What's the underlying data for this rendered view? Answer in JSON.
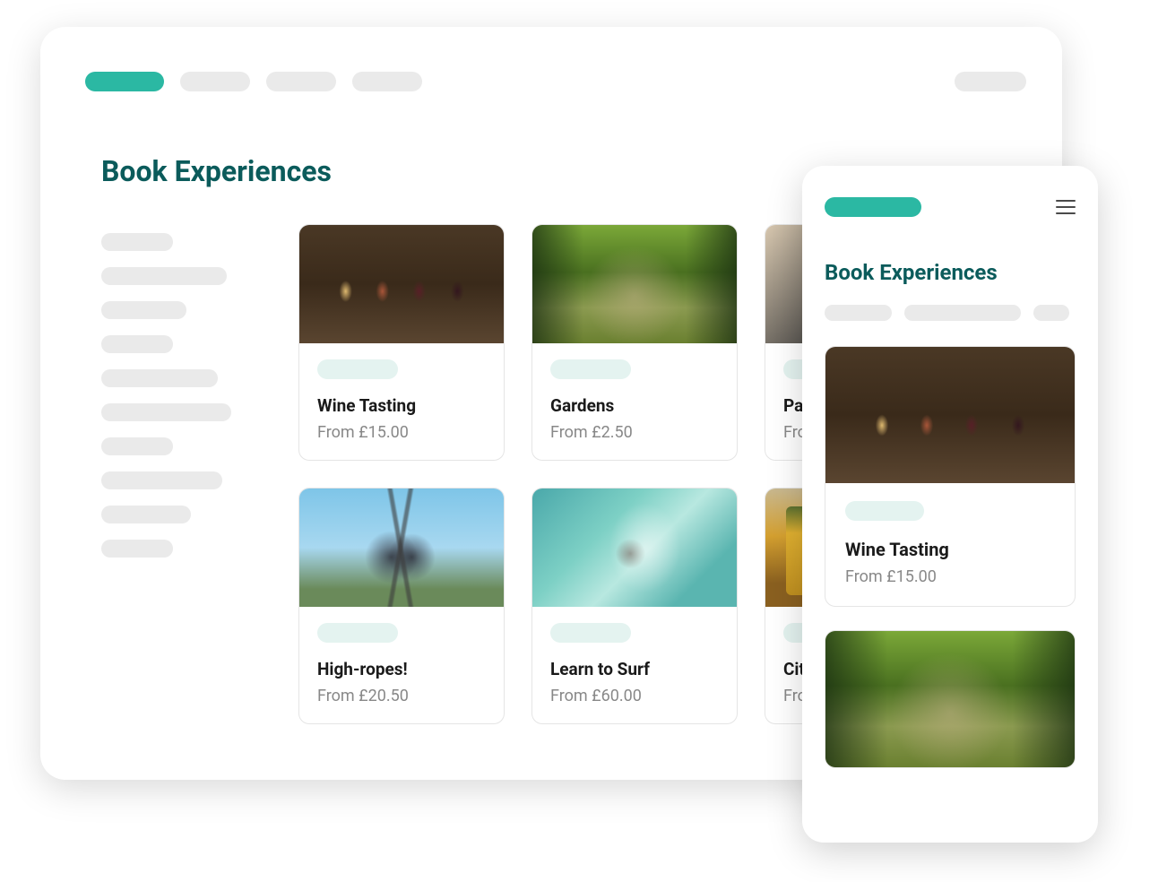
{
  "desktop": {
    "title": "Book Experiences",
    "cards": [
      {
        "title": "Wine Tasting",
        "price": "From £15.00"
      },
      {
        "title": "Gardens",
        "price": "From £2.50"
      },
      {
        "title": "Pa",
        "price": "Fro"
      },
      {
        "title": "High-ropes!",
        "price": "From £20.50"
      },
      {
        "title": "Learn to Surf",
        "price": "From £60.00"
      },
      {
        "title": "Cit",
        "price": "Fro"
      }
    ]
  },
  "mobile": {
    "title": "Book Experiences",
    "cards": [
      {
        "title": "Wine Tasting",
        "price": "From £15.00"
      }
    ]
  },
  "colors": {
    "accent": "#2BB8A3",
    "heading": "#0B5B5B",
    "skeleton": "#EAEAEA",
    "tag": "#E4F3F0"
  }
}
